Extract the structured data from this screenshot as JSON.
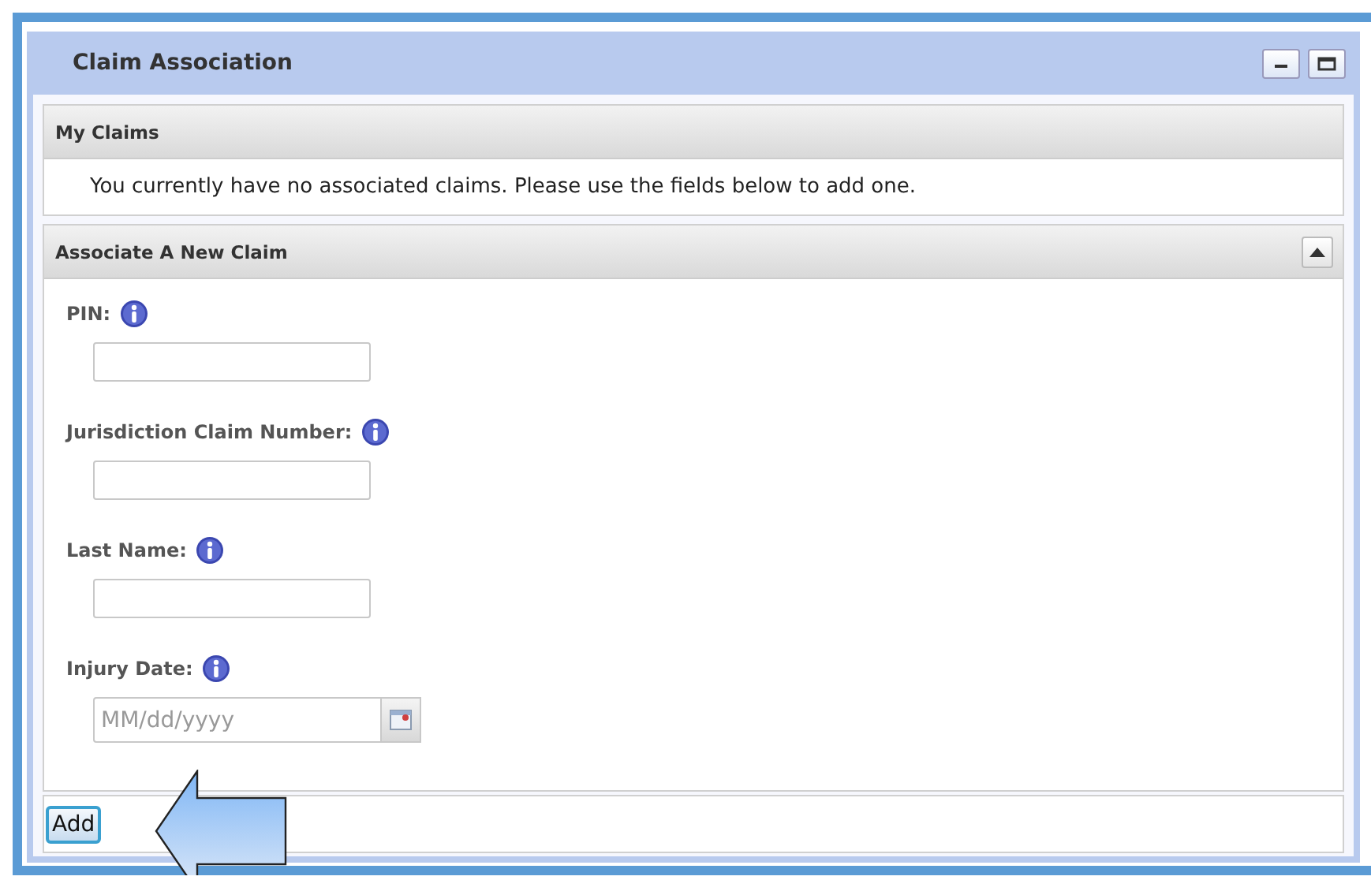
{
  "window": {
    "title": "Claim Association"
  },
  "my_claims": {
    "title": "My Claims",
    "message": "You currently have no associated claims. Please use the fields below to add one."
  },
  "new_claim": {
    "title": "Associate A New Claim",
    "expanded": true,
    "fields": [
      {
        "kind": "text",
        "label": "PIN:"
      },
      {
        "kind": "text",
        "label": "Jurisdiction Claim Number:"
      },
      {
        "kind": "text",
        "label": "Last Name:"
      },
      {
        "kind": "date",
        "label": "Injury Date:",
        "placeholder": "MM/dd/yyyy"
      }
    ]
  },
  "buttons": [
    "Add"
  ]
}
